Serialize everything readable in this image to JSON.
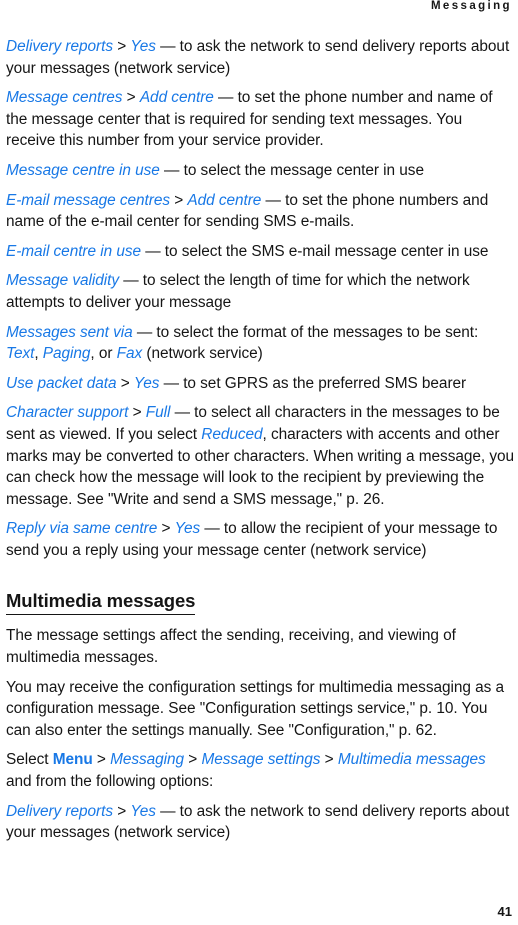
{
  "page": {
    "running_head": "Messaging",
    "folio": "41",
    "accent_color": "#1878e6",
    "text_color": "#151515",
    "background_color": "#ffffff"
  },
  "blocks": [
    {
      "id": "delivery-reports-sms",
      "type": "paragraph",
      "runs": [
        {
          "text": "Delivery reports",
          "style": "blue-italic"
        },
        {
          "text": " > ",
          "style": "plain"
        },
        {
          "text": "Yes",
          "style": "blue-italic"
        },
        {
          "text": " — to ask the network to send delivery reports about your messages (network service)",
          "style": "plain"
        }
      ]
    },
    {
      "id": "message-centres",
      "type": "paragraph",
      "runs": [
        {
          "text": "Message centres",
          "style": "blue-italic"
        },
        {
          "text": " > ",
          "style": "plain"
        },
        {
          "text": "Add centre",
          "style": "blue-italic"
        },
        {
          "text": " — to set the phone number and name of the message center that is required for sending text messages. You receive this number from your service provider.",
          "style": "plain"
        }
      ]
    },
    {
      "id": "message-centre-in-use",
      "type": "paragraph",
      "runs": [
        {
          "text": "Message centre in use",
          "style": "blue-italic"
        },
        {
          "text": " — to select the message center in use",
          "style": "plain"
        }
      ]
    },
    {
      "id": "email-message-centres",
      "type": "paragraph",
      "runs": [
        {
          "text": "E-mail message centres",
          "style": "blue-italic"
        },
        {
          "text": " > ",
          "style": "plain"
        },
        {
          "text": "Add centre",
          "style": "blue-italic"
        },
        {
          "text": " — to set the phone numbers and name of the e-mail center for sending SMS e-mails.",
          "style": "plain"
        }
      ]
    },
    {
      "id": "email-centre-in-use",
      "type": "paragraph",
      "runs": [
        {
          "text": "E-mail centre in use",
          "style": "blue-italic"
        },
        {
          "text": " — to select the SMS e-mail message center in use",
          "style": "plain"
        }
      ]
    },
    {
      "id": "message-validity",
      "type": "paragraph",
      "runs": [
        {
          "text": "Message validity",
          "style": "blue-italic"
        },
        {
          "text": " — to select the length of time for which the network attempts to deliver your message",
          "style": "plain"
        }
      ]
    },
    {
      "id": "messages-sent-via",
      "type": "paragraph",
      "runs": [
        {
          "text": "Messages sent via",
          "style": "blue-italic"
        },
        {
          "text": " — to select the format of the messages to be sent: ",
          "style": "plain"
        },
        {
          "text": "Text",
          "style": "blue-italic"
        },
        {
          "text": ", ",
          "style": "plain"
        },
        {
          "text": "Paging",
          "style": "blue-italic"
        },
        {
          "text": ", or ",
          "style": "plain"
        },
        {
          "text": "Fax",
          "style": "blue-italic"
        },
        {
          "text": " (network service)",
          "style": "plain"
        }
      ]
    },
    {
      "id": "use-packet-data",
      "type": "paragraph",
      "runs": [
        {
          "text": "Use packet data",
          "style": "blue-italic"
        },
        {
          "text": " > ",
          "style": "plain"
        },
        {
          "text": "Yes",
          "style": "blue-italic"
        },
        {
          "text": " — to set GPRS as the preferred SMS bearer",
          "style": "plain"
        }
      ]
    },
    {
      "id": "character-support",
      "type": "paragraph",
      "runs": [
        {
          "text": "Character support",
          "style": "blue-italic"
        },
        {
          "text": " > ",
          "style": "plain"
        },
        {
          "text": "Full",
          "style": "blue-italic"
        },
        {
          "text": " — to select all characters in the messages to be sent as viewed. If you select ",
          "style": "plain"
        },
        {
          "text": "Reduced",
          "style": "blue-italic"
        },
        {
          "text": ", characters with accents and other marks may be converted to other characters. When writing a message, you can check how the message will look to the recipient by previewing the message. See \"Write and send a SMS message,\" p. 26.",
          "style": "plain"
        }
      ]
    },
    {
      "id": "reply-via-same-centre",
      "type": "paragraph",
      "runs": [
        {
          "text": "Reply via same centre",
          "style": "blue-italic"
        },
        {
          "text": " > ",
          "style": "plain"
        },
        {
          "text": "Yes",
          "style": "blue-italic"
        },
        {
          "text": " — to allow the recipient of your message to send you a reply using your message center (network service)",
          "style": "plain"
        }
      ]
    },
    {
      "id": "multimedia-messages-heading",
      "type": "heading",
      "text": "Multimedia messages"
    },
    {
      "id": "mms-intro",
      "type": "paragraph",
      "runs": [
        {
          "text": "The message settings affect the sending, receiving, and viewing of multimedia messages.",
          "style": "plain"
        }
      ]
    },
    {
      "id": "mms-config",
      "type": "paragraph",
      "runs": [
        {
          "text": "You may receive the configuration settings for multimedia messaging as a configuration message. See \"Configuration settings service,\" p. 10. You can also enter the settings manually. See \"Configuration,\" p. 62.",
          "style": "plain"
        }
      ]
    },
    {
      "id": "mms-select-path",
      "type": "paragraph",
      "runs": [
        {
          "text": "Select ",
          "style": "plain"
        },
        {
          "text": "Menu",
          "style": "blue-bold"
        },
        {
          "text": " > ",
          "style": "plain"
        },
        {
          "text": "Messaging",
          "style": "blue-italic"
        },
        {
          "text": " > ",
          "style": "plain"
        },
        {
          "text": "Message settings",
          "style": "blue-italic"
        },
        {
          "text": " > ",
          "style": "plain"
        },
        {
          "text": "Multimedia messages",
          "style": "blue-italic"
        },
        {
          "text": " and from the following options:",
          "style": "plain"
        }
      ]
    },
    {
      "id": "delivery-reports-mms",
      "type": "paragraph",
      "runs": [
        {
          "text": "Delivery reports",
          "style": "blue-italic"
        },
        {
          "text": " > ",
          "style": "plain"
        },
        {
          "text": "Yes",
          "style": "blue-italic"
        },
        {
          "text": " — to ask the network to send delivery reports about your messages (network service)",
          "style": "plain"
        }
      ]
    }
  ]
}
